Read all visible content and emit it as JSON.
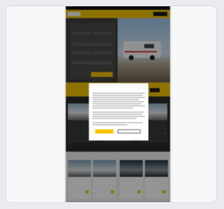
{
  "nav": {
    "items": [
      "",
      "",
      "",
      ""
    ]
  },
  "header": {
    "logo_text": "",
    "button_label": ""
  },
  "hero": {
    "form_title": "",
    "fields": [
      "",
      "",
      "",
      "",
      "",
      ""
    ],
    "search_button": ""
  },
  "promo": {
    "text": "",
    "button": ""
  },
  "listing": {
    "cards": [
      {
        "name": "",
        "price": ""
      },
      {
        "name": "",
        "price": ""
      },
      {
        "name": "",
        "price": ""
      }
    ]
  },
  "sections": {
    "left_title": "",
    "right_title": "",
    "cards": [
      {
        "name": "",
        "price": ""
      },
      {
        "name": "",
        "price": ""
      },
      {
        "name": "",
        "price": ""
      },
      {
        "name": "",
        "price": ""
      }
    ]
  },
  "footer": {
    "text": ""
  },
  "cookie_modal": {
    "title": "",
    "language": "",
    "accept_label": "",
    "decline_label": "",
    "link_left": "",
    "link_right": ""
  },
  "colors": {
    "brand_yellow": "#f5c400",
    "dark": "#1b1b1b",
    "card_bg": "#f7f8f9"
  }
}
